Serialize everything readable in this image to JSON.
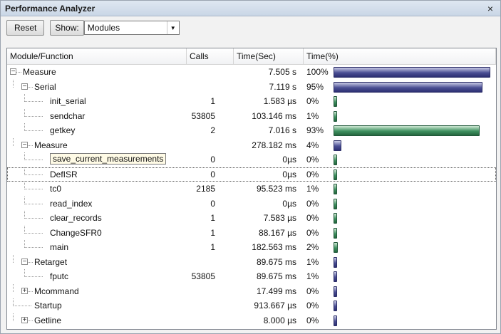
{
  "window": {
    "title": "Performance Analyzer",
    "close_glyph": "×"
  },
  "toolbar": {
    "reset_label": "Reset",
    "show_label": "Show:",
    "show_value": "Modules"
  },
  "columns": {
    "name": "Module/Function",
    "calls": "Calls",
    "time_sec": "Time(Sec)",
    "time_pct": "Time(%)"
  },
  "colors": {
    "bar_blue": "#3a3d80",
    "bar_green": "#3f9160"
  },
  "rows": [
    {
      "name": "Measure",
      "level": 0,
      "expander": "−",
      "calls": "",
      "time": "7.505 s",
      "pct": "100%",
      "pct_value": 100,
      "bar": "blue"
    },
    {
      "name": "Serial",
      "level": 1,
      "expander": "−",
      "calls": "",
      "time": "7.119 s",
      "pct": "95%",
      "pct_value": 95,
      "bar": "blue"
    },
    {
      "name": "init_serial",
      "level": 2,
      "expander": "",
      "calls": "1",
      "time": "1.583 µs",
      "pct": "0%",
      "pct_value": 0,
      "bar": "green"
    },
    {
      "name": "sendchar",
      "level": 2,
      "expander": "",
      "calls": "53805",
      "time": "103.146 ms",
      "pct": "1%",
      "pct_value": 1,
      "bar": "green"
    },
    {
      "name": "getkey",
      "level": 2,
      "expander": "",
      "calls": "2",
      "time": "7.016 s",
      "pct": "93%",
      "pct_value": 93,
      "bar": "green"
    },
    {
      "name": "Measure",
      "level": 1,
      "expander": "−",
      "calls": "",
      "time": "278.182 ms",
      "pct": "4%",
      "pct_value": 4,
      "bar": "blue"
    },
    {
      "name": "save_current_measurements",
      "level": 2,
      "expander": "",
      "calls": "0",
      "time": "0µs",
      "pct": "0%",
      "pct_value": 0,
      "bar": "green",
      "highlight": true
    },
    {
      "name": "DefISR",
      "level": 2,
      "expander": "",
      "calls": "0",
      "time": "0µs",
      "pct": "0%",
      "pct_value": 0,
      "bar": "green",
      "outline": true
    },
    {
      "name": "tc0",
      "level": 2,
      "expander": "",
      "calls": "2185",
      "time": "95.523 ms",
      "pct": "1%",
      "pct_value": 1,
      "bar": "green"
    },
    {
      "name": "read_index",
      "level": 2,
      "expander": "",
      "calls": "0",
      "time": "0µs",
      "pct": "0%",
      "pct_value": 0,
      "bar": "green"
    },
    {
      "name": "clear_records",
      "level": 2,
      "expander": "",
      "calls": "1",
      "time": "7.583 µs",
      "pct": "0%",
      "pct_value": 0,
      "bar": "green"
    },
    {
      "name": "ChangeSFR0",
      "level": 2,
      "expander": "",
      "calls": "1",
      "time": "88.167 µs",
      "pct": "0%",
      "pct_value": 0,
      "bar": "green"
    },
    {
      "name": "main",
      "level": 2,
      "expander": "",
      "calls": "1",
      "time": "182.563 ms",
      "pct": "2%",
      "pct_value": 2,
      "bar": "green"
    },
    {
      "name": "Retarget",
      "level": 1,
      "expander": "−",
      "calls": "",
      "time": "89.675 ms",
      "pct": "1%",
      "pct_value": 1,
      "bar": "blue"
    },
    {
      "name": "fputc",
      "level": 2,
      "expander": "",
      "calls": "53805",
      "time": "89.675 ms",
      "pct": "1%",
      "pct_value": 1,
      "bar": "blue"
    },
    {
      "name": "Mcommand",
      "level": 1,
      "expander": "+",
      "calls": "",
      "time": "17.499 ms",
      "pct": "0%",
      "pct_value": 0,
      "bar": "blue"
    },
    {
      "name": "Startup",
      "level": 1,
      "expander": "",
      "calls": "",
      "time": "913.667 µs",
      "pct": "0%",
      "pct_value": 0,
      "bar": "blue"
    },
    {
      "name": "Getline",
      "level": 1,
      "expander": "+",
      "calls": "",
      "time": "8.000 µs",
      "pct": "0%",
      "pct_value": 0,
      "bar": "blue"
    }
  ]
}
